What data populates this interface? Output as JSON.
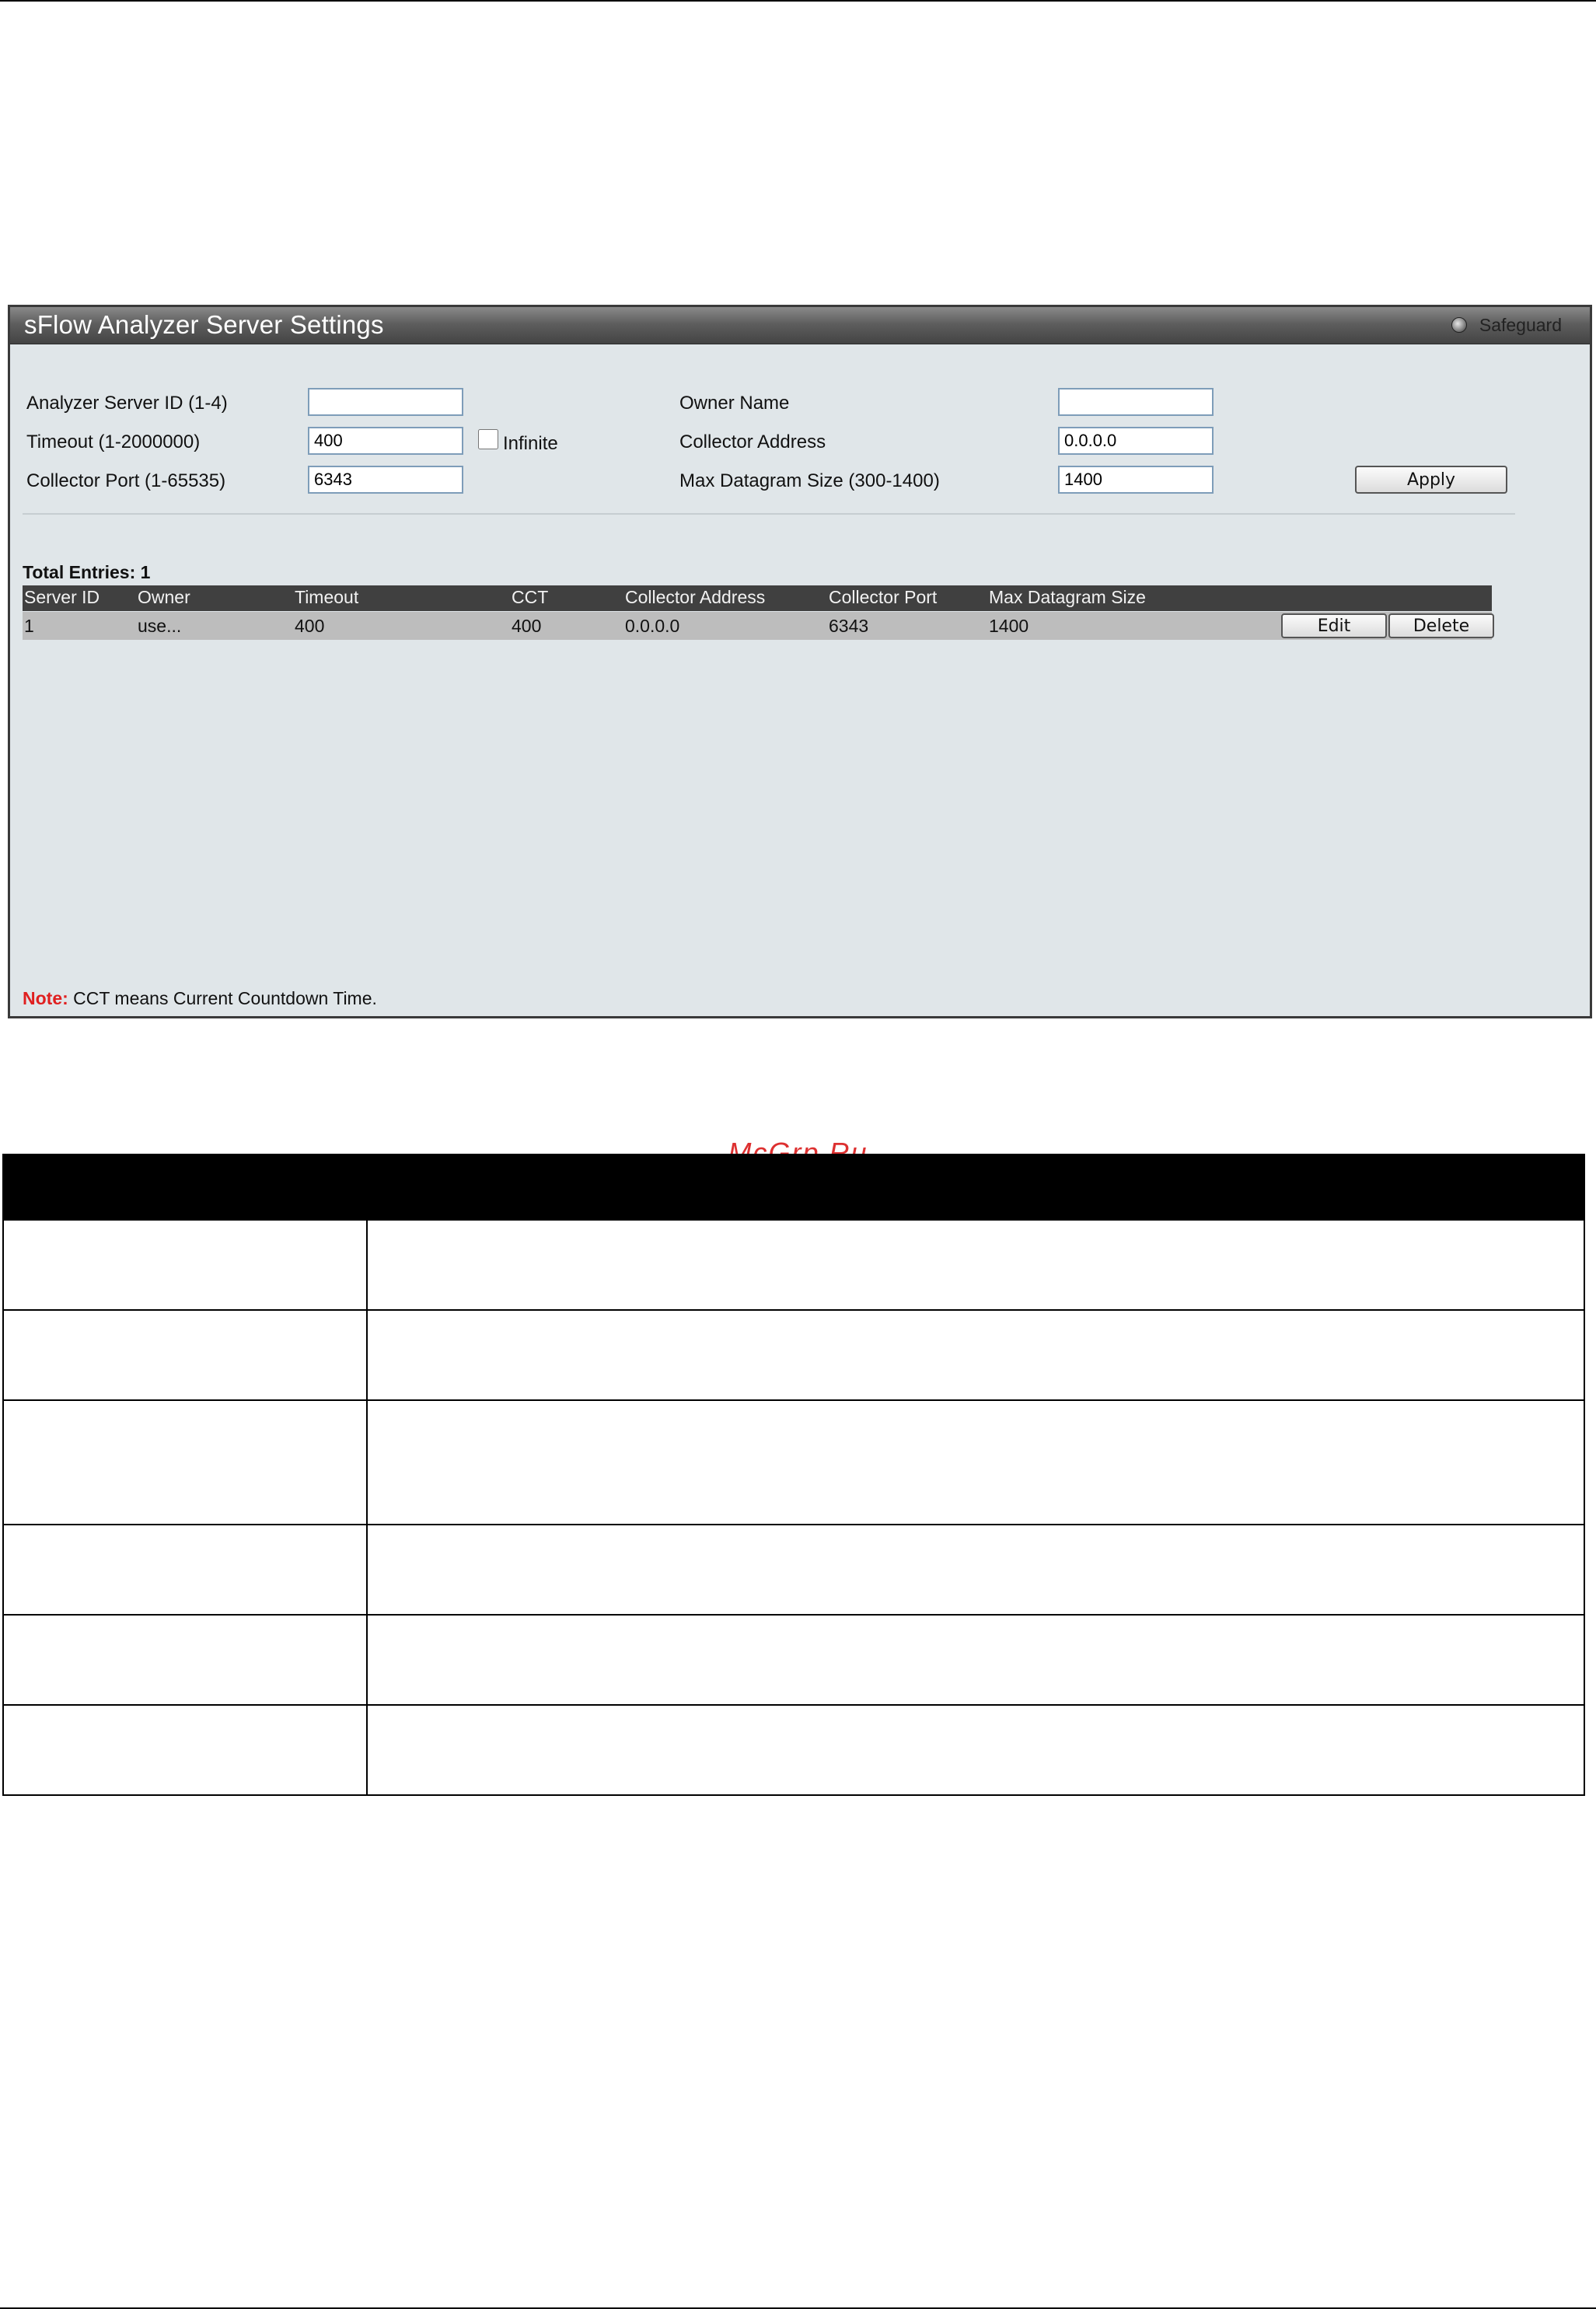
{
  "panel": {
    "title": "sFlow Analyzer Server Settings",
    "safeguard_label": "Safeguard"
  },
  "form": {
    "analyzer_server_id": {
      "label": "Analyzer Server ID (1-4)",
      "value": ""
    },
    "timeout": {
      "label": "Timeout (1-2000000)",
      "value": "400"
    },
    "infinite": {
      "label": "Infinite",
      "checked": false
    },
    "collector_port": {
      "label": "Collector Port (1-65535)",
      "value": "6343"
    },
    "owner_name": {
      "label": "Owner Name",
      "value": ""
    },
    "collector_address": {
      "label": "Collector Address",
      "value": "0.0.0.0"
    },
    "max_datagram_size": {
      "label": "Max Datagram Size (300-1400)",
      "value": "1400"
    },
    "apply_label": "Apply"
  },
  "table": {
    "total_entries": "Total Entries: 1",
    "headers": [
      "Server ID",
      "Owner",
      "Timeout",
      "CCT",
      "Collector Address",
      "Collector Port",
      "Max Datagram Size"
    ],
    "rows": [
      {
        "server_id": "1",
        "owner": "use...",
        "timeout": "400",
        "cct": "400",
        "collector_address": "0.0.0.0",
        "collector_port": "6343",
        "max_datagram_size": "1400"
      }
    ],
    "edit_label": "Edit",
    "delete_label": "Delete"
  },
  "note": {
    "prefix": "Note:",
    "text": " CCT means Current Countdown Time."
  },
  "watermark": "McGrp.Ru"
}
